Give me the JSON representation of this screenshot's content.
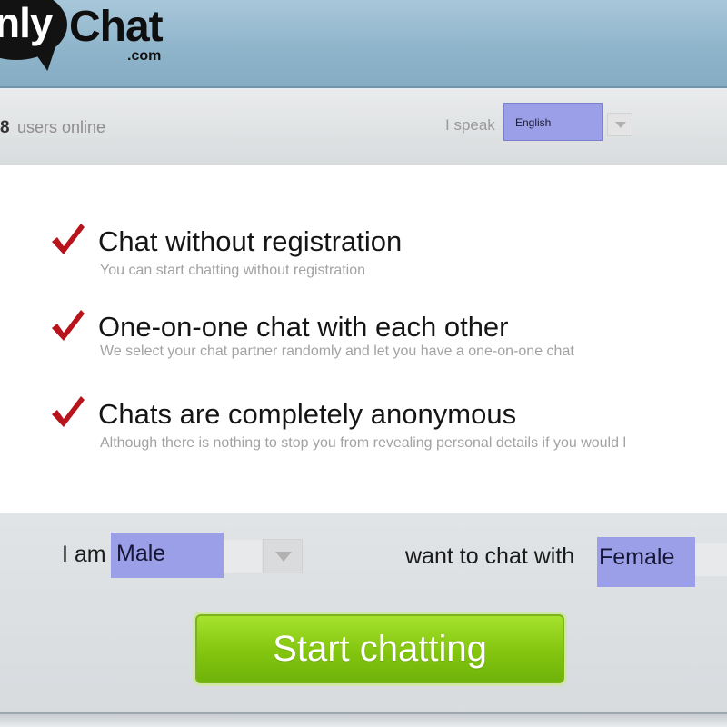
{
  "logo": {
    "left_text": "nly",
    "main_text": "Chat",
    "sub_text": ".com"
  },
  "status": {
    "users_count": "8",
    "users_label": "users online"
  },
  "language": {
    "label": "I speak",
    "selected": "English"
  },
  "features": [
    {
      "title": "Chat without registration",
      "desc": "You can start chatting without registration"
    },
    {
      "title": "One-on-one chat with each other",
      "desc": "We select your chat partner randomly and let you have a one-on-one chat"
    },
    {
      "title": "Chats are completely anonymous",
      "desc": "Although there is nothing to stop you from revealing personal details if you would l"
    }
  ],
  "form": {
    "iam_label": "I am",
    "gender_selected": "Male",
    "want_label": "want to chat with",
    "partner_selected": "Female",
    "start_button": "Start chatting"
  },
  "colors": {
    "header": "#8fb5cb",
    "select_highlight": "#9b9fe7",
    "check": "#b8141c",
    "button": "#83c50f"
  }
}
